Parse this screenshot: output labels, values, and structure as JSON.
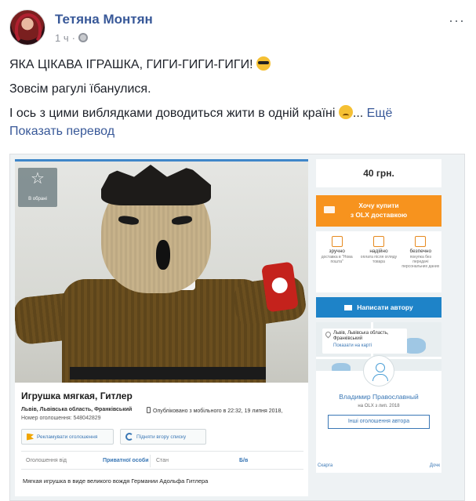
{
  "post": {
    "author": "Тетяна Монтян",
    "time": "1 ч",
    "line1": "ЯКА ЦІКАВА ІГРАШКА, ГИГИ-ГИГИ-ГИГИ!",
    "line2": "Зовсім рагулі їбанулися.",
    "line3": "І ось з цими виблядками доводиться жити в одній країні",
    "ellipsis": "...",
    "see_more": "Ещё",
    "translate": "Показать перевод",
    "more_menu": "···"
  },
  "icons": [
    "avatar",
    "globe-icon",
    "sunglasses-emoji",
    "sad-emoji",
    "star-icon",
    "truck-icon",
    "mail-icon",
    "pin-icon",
    "phone-icon",
    "flag-icon",
    "refresh-icon"
  ],
  "listing": {
    "favorite_label": "В обрані",
    "title": "Игрушка мягкая, Гитлер",
    "location": "Львів, Львівська область, Франківський",
    "published": "Опубліковано з мобільного  в 22:32, 19 липня 2018,",
    "number": "Номер оголошення: 548042829",
    "promote": "Рекламувати оголошення",
    "raise": "Підняти вгору списку",
    "params": [
      {
        "key": "Оголошення від",
        "value": "Приватної особи"
      },
      {
        "key": "Стан",
        "value": "Б/в"
      }
    ],
    "description": "Мягкая игрушка в виде великого вождя Германии Адольфа Гитлера",
    "price": "40 грн.",
    "buy_line1": "Хочу купити",
    "buy_line2": "з OLX доставкою",
    "features": [
      {
        "title": "зручно",
        "desc": "доставка в \"Нова пошта\""
      },
      {
        "title": "надійно",
        "desc": "оплата після огляду товара"
      },
      {
        "title": "безпечно",
        "desc": "покупка без передачі персональних даних"
      }
    ],
    "message": "Написати автору",
    "map_address": "Львів, Львівська область, Франківський",
    "map_link": "Показати на карті",
    "seller_name": "Владимир Православный",
    "seller_since": "на OLX з лип. 2018",
    "other_ads": "Інші оголошення автора",
    "foot_left": "Скарга",
    "foot_right": "Дочк"
  }
}
